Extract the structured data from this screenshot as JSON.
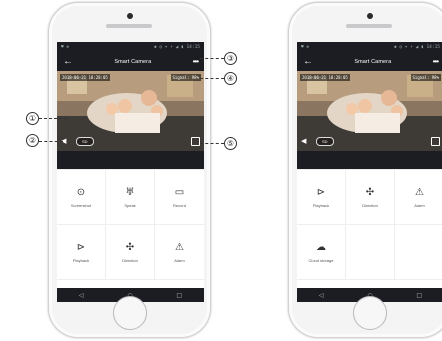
{
  "status_bar": {
    "left": "♥ ⊕",
    "right": "✱ ◎ ▾ ⚡ ◢ ▮ 14:15"
  },
  "app": {
    "title": "Smart Camera",
    "back_icon": "back-arrow-icon",
    "more_icon": "more-dots-icon",
    "more_label": "•••"
  },
  "video": {
    "timestamp": "2018-06-21 18:28:05",
    "signal": "Signal: 98%",
    "quality": "SD"
  },
  "left_phone": {
    "controls": [
      {
        "icon": "camera-icon",
        "glyph": "⊙",
        "label": "Screenshot"
      },
      {
        "icon": "microphone-icon",
        "glyph": "♅",
        "label": "Speak"
      },
      {
        "icon": "record-icon",
        "glyph": "▭",
        "label": "Record"
      },
      {
        "icon": "playback-icon",
        "glyph": "⊳",
        "label": "Playback"
      },
      {
        "icon": "direction-icon",
        "glyph": "✣",
        "label": "Direction"
      },
      {
        "icon": "alarm-icon",
        "glyph": "⚠",
        "label": "Alarm"
      }
    ]
  },
  "right_phone": {
    "controls": [
      {
        "icon": "playback-icon",
        "glyph": "⊳",
        "label": "Playback"
      },
      {
        "icon": "direction-icon",
        "glyph": "✣",
        "label": "Direction"
      },
      {
        "icon": "alarm-icon",
        "glyph": "⚠",
        "label": "Alarm"
      },
      {
        "icon": "cloud-storage-icon",
        "glyph": "☁",
        "label": "Cloud storage"
      }
    ]
  },
  "navbar": {
    "back": "◁",
    "home": "○",
    "recent": "□"
  },
  "callouts": [
    "①",
    "②",
    "③",
    "④",
    "⑤"
  ]
}
